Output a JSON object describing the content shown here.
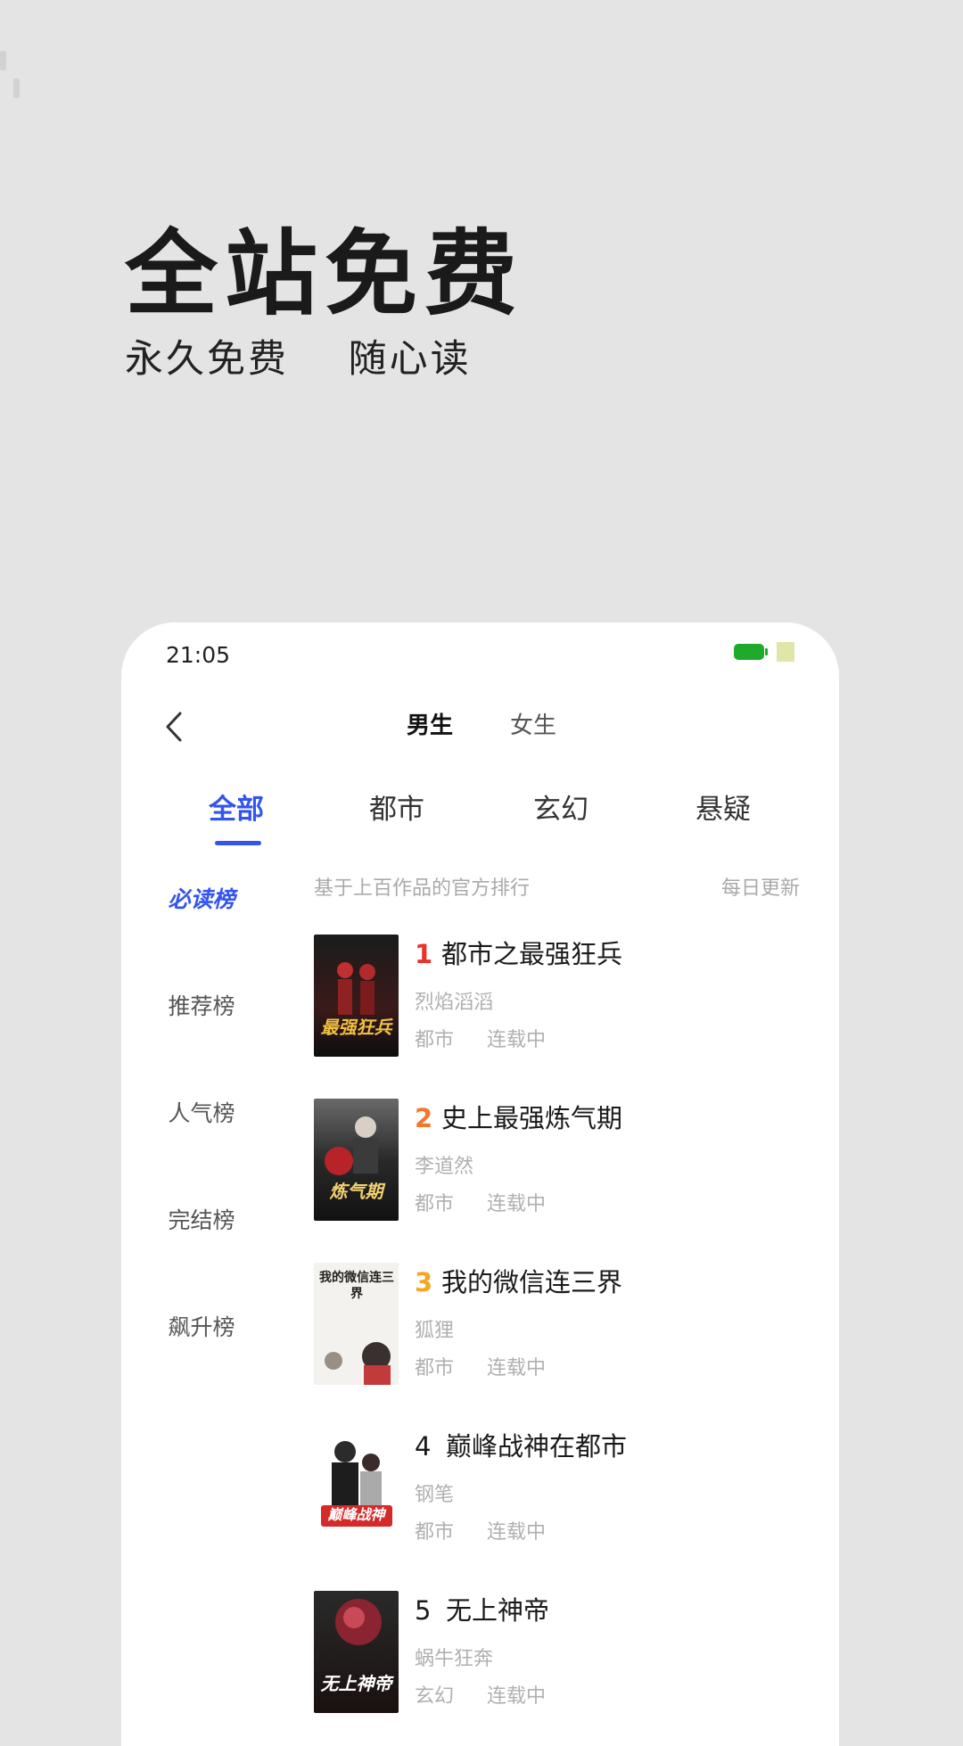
{
  "promo": {
    "title": "全站免费",
    "subtitle": "永久免费    随心读"
  },
  "status_bar": {
    "time": "21:05"
  },
  "header": {
    "gender_tabs": [
      "男生",
      "女生"
    ],
    "active_gender": "男生"
  },
  "category_tabs": [
    {
      "label": "全部",
      "active": true
    },
    {
      "label": "都市",
      "active": false
    },
    {
      "label": "玄幻",
      "active": false
    },
    {
      "label": "悬疑",
      "active": false
    }
  ],
  "sidebar": [
    {
      "label": "必读榜",
      "active": true
    },
    {
      "label": "推荐榜",
      "active": false
    },
    {
      "label": "人气榜",
      "active": false
    },
    {
      "label": "完结榜",
      "active": false
    },
    {
      "label": "飙升榜",
      "active": false
    }
  ],
  "list_header": {
    "description": "基于上百作品的官方排行",
    "update": "每日更新"
  },
  "books": [
    {
      "rank": "1",
      "title": "都市之最强狂兵",
      "author": "烈焰滔滔",
      "category": "都市",
      "status": "连载中",
      "cover_text": "最强狂兵"
    },
    {
      "rank": "2",
      "title": "史上最强炼气期",
      "author": "李道然",
      "category": "都市",
      "status": "连载中",
      "cover_text": "炼气期"
    },
    {
      "rank": "3",
      "title": "我的微信连三界",
      "author": "狐狸",
      "category": "都市",
      "status": "连载中",
      "cover_text": "我的微信连三界"
    },
    {
      "rank": "4",
      "title": "巅峰战神在都市",
      "author": "钢笔",
      "category": "都市",
      "status": "连载中",
      "cover_text": "巅峰战神"
    },
    {
      "rank": "5",
      "title": "无上神帝",
      "author": "蜗牛狂奔",
      "category": "玄幻",
      "status": "连载中",
      "cover_text": "无上神帝"
    }
  ],
  "colors": {
    "accent": "#3355ee",
    "rank1": "#e8322d",
    "rank2": "#f4772b",
    "rank3": "#f5a623",
    "rank_default": "#1a1a1a"
  }
}
